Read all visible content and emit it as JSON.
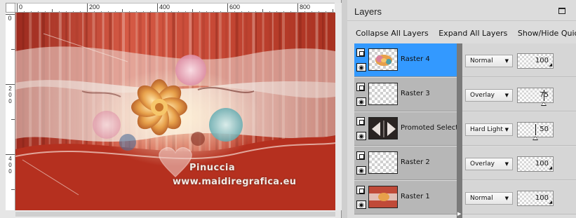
{
  "canvas": {
    "ruler_top_labels": [
      "0",
      "200",
      "400",
      "600",
      "800"
    ],
    "ruler_left_labels": [
      "0",
      "200",
      "400"
    ],
    "watermark": {
      "name": "Pinuccia",
      "url": "www.maidiregrafica.eu"
    }
  },
  "palette": {
    "title": "Layers",
    "toolbar": {
      "collapse_label": "Collapse All Layers",
      "expand_label": "Expand All Layers",
      "show_hide_label": "Show/Hide Quick Se"
    },
    "layers": [
      {
        "name": "Raster 4",
        "blend_mode": "Normal",
        "opacity": 100,
        "selected": true
      },
      {
        "name": "Raster 3",
        "blend_mode": "Overlay",
        "opacity": 75,
        "selected": false
      },
      {
        "name": "Promoted Selection",
        "blend_mode": "Hard Light",
        "opacity": 50,
        "selected": false
      },
      {
        "name": "Raster 2",
        "blend_mode": "Overlay",
        "opacity": 100,
        "selected": false
      },
      {
        "name": "Raster 1",
        "blend_mode": "Normal",
        "opacity": 100,
        "selected": false
      }
    ],
    "colors": {
      "selection": "#3399ff",
      "layer_row": "#b7b7b7"
    }
  }
}
